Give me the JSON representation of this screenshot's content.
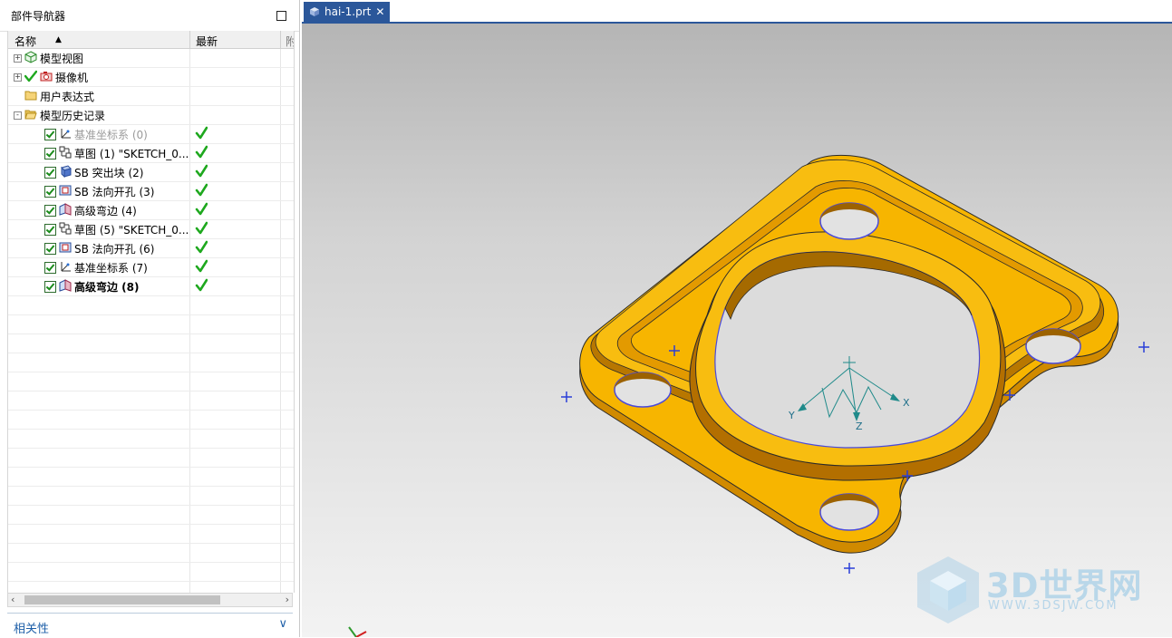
{
  "navigator": {
    "title": "部件导航器",
    "columns": {
      "name": "名称",
      "latest": "最新",
      "extra": "附"
    },
    "tree": [
      {
        "label": "模型视图",
        "level": 0,
        "expander": "+",
        "icon": "model-views-icon",
        "checkbox": false,
        "latest": false,
        "style": "normal"
      },
      {
        "label": "摄像机",
        "level": 0,
        "expander": "+",
        "icon": "camera-icon",
        "checkbox": false,
        "latest": false,
        "style": "normal"
      },
      {
        "label": "用户表达式",
        "level": 0,
        "expander": "",
        "icon": "folder-icon",
        "checkbox": false,
        "latest": false,
        "style": "normal"
      },
      {
        "label": "模型历史记录",
        "level": 0,
        "expander": "-",
        "icon": "folder-open-icon",
        "checkbox": false,
        "latest": false,
        "style": "normal"
      },
      {
        "label": "基准坐标系 (0)",
        "level": 1,
        "expander": "",
        "icon": "datum-csys-icon",
        "checkbox": true,
        "latest": true,
        "style": "gray"
      },
      {
        "label": "草图 (1) \"SKETCH_0...",
        "level": 1,
        "expander": "",
        "icon": "sketch-icon",
        "checkbox": true,
        "latest": true,
        "style": "normal"
      },
      {
        "label": "SB 突出块 (2)",
        "level": 1,
        "expander": "",
        "icon": "tab-feature-icon",
        "checkbox": true,
        "latest": true,
        "style": "normal"
      },
      {
        "label": "SB 法向开孔 (3)",
        "level": 1,
        "expander": "",
        "icon": "normal-cutout-icon",
        "checkbox": true,
        "latest": true,
        "style": "normal"
      },
      {
        "label": "高级弯边 (4)",
        "level": 1,
        "expander": "",
        "icon": "advanced-flange-icon",
        "checkbox": true,
        "latest": true,
        "style": "normal"
      },
      {
        "label": "草图 (5) \"SKETCH_0...",
        "level": 1,
        "expander": "",
        "icon": "sketch-icon",
        "checkbox": true,
        "latest": true,
        "style": "normal"
      },
      {
        "label": "SB 法向开孔 (6)",
        "level": 1,
        "expander": "",
        "icon": "normal-cutout-icon",
        "checkbox": true,
        "latest": true,
        "style": "normal"
      },
      {
        "label": "基准坐标系 (7)",
        "level": 1,
        "expander": "",
        "icon": "datum-csys-icon",
        "checkbox": true,
        "latest": true,
        "style": "normal"
      },
      {
        "label": "高级弯边 (8)",
        "level": 1,
        "expander": "",
        "icon": "advanced-flange-icon",
        "checkbox": true,
        "latest": true,
        "style": "bold"
      }
    ],
    "related": "相关性"
  },
  "document_tab": {
    "label": "hai-1.prt",
    "close": "✕"
  },
  "viewport": {
    "axis_labels": {
      "x": "X",
      "y": "Y",
      "z": "Z"
    },
    "part_color": "#f7b500",
    "edge_color": "#4a4adb"
  },
  "watermark": {
    "brand": "3D世界网",
    "url": "WWW.3DSJW.COM"
  }
}
